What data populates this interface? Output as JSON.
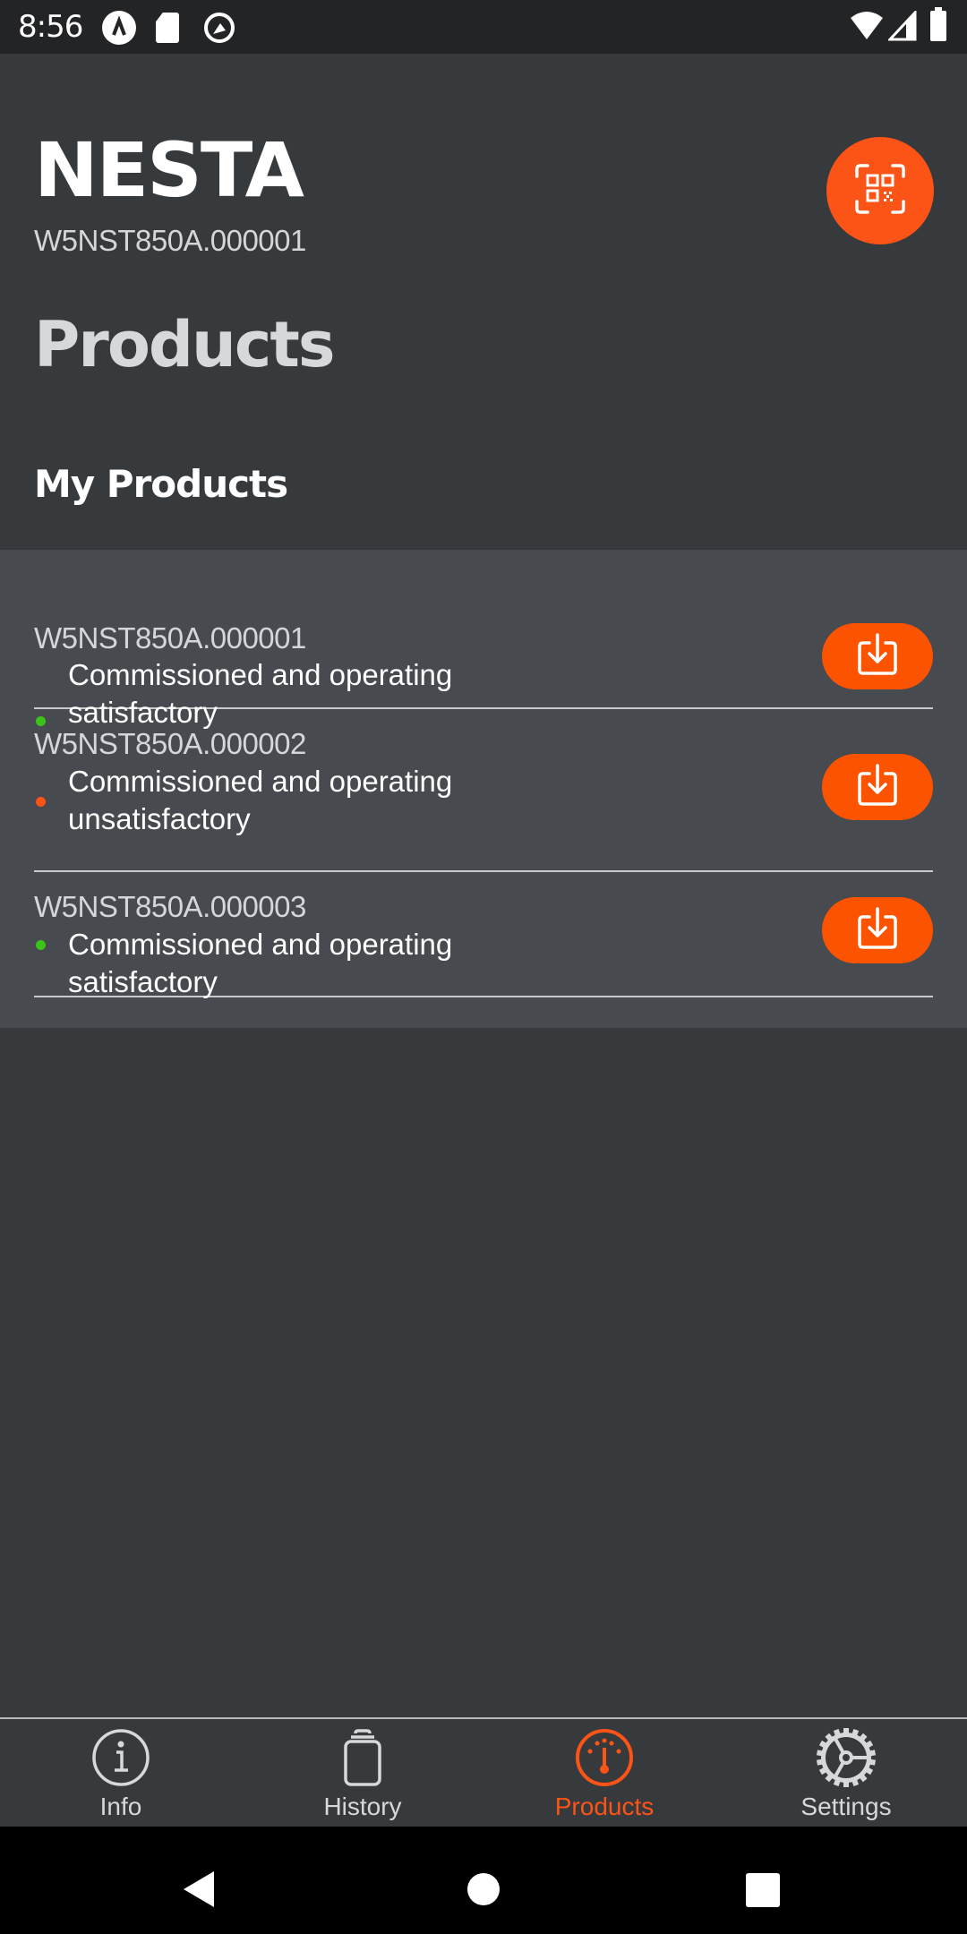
{
  "status_bar": {
    "time": "8:56",
    "left_icons": [
      "app-notification-icon",
      "sd-card-icon",
      "data-saver-icon"
    ],
    "right_icons": [
      "wifi-icon",
      "cellular-signal-icon",
      "battery-icon"
    ]
  },
  "header": {
    "brand": "NESTA",
    "serial": "W5NST850A.000001",
    "qr_button_icon": "qr-scan-icon"
  },
  "page_title": "Products",
  "section_title": "My Products",
  "colors": {
    "accent": "#fc5316",
    "status_ok": "#3ac417",
    "status_warn": "#fc5316",
    "background": "#373a3d",
    "card": "#474a4f"
  },
  "products": [
    {
      "serial": "W5NST850A.000001",
      "status": "Commissioned and operating satisfactory",
      "status_level": "ok",
      "action_icon": "download-icon"
    },
    {
      "serial": "W5NST850A.000002",
      "status": "Commissioned and operating unsatisfactory",
      "status_level": "warn",
      "action_icon": "download-icon"
    },
    {
      "serial": "W5NST850A.000003",
      "status": "Commissioned and operating satisfactory",
      "status_level": "ok",
      "action_icon": "download-icon"
    }
  ],
  "bottom_nav": {
    "items": [
      {
        "label": "Info",
        "icon": "info-icon",
        "active": false
      },
      {
        "label": "History",
        "icon": "history-icon",
        "active": false
      },
      {
        "label": "Products",
        "icon": "gauge-icon",
        "active": true
      },
      {
        "label": "Settings",
        "icon": "gear-icon",
        "active": false
      }
    ]
  },
  "system_nav": {
    "buttons": [
      "back",
      "home",
      "recents"
    ]
  }
}
